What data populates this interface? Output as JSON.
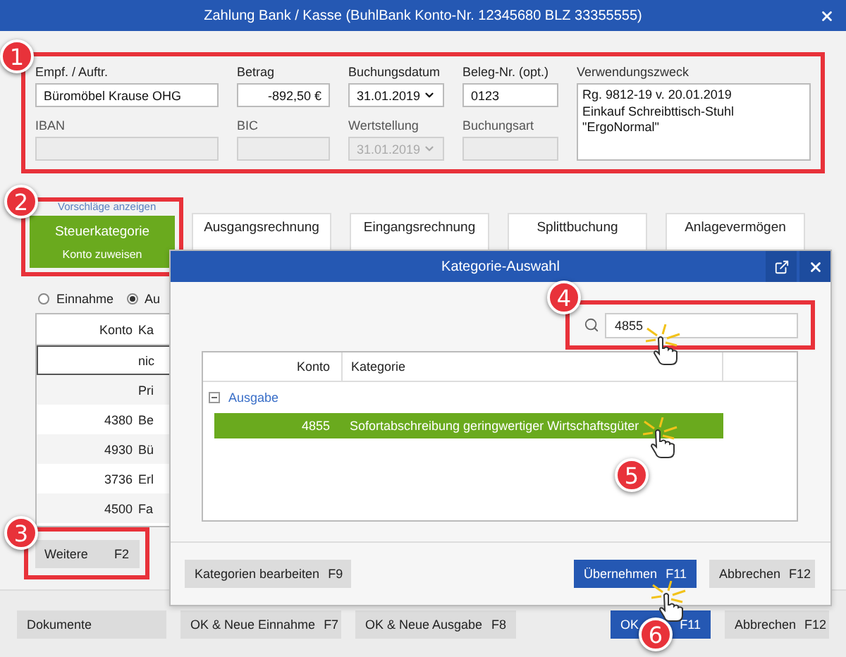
{
  "window": {
    "title": "Zahlung Bank / Kasse (BuhlBank Konto-Nr. 12345680  BLZ 33355555)"
  },
  "fields": [
    {
      "label": "Empf. / Auftr.",
      "value": "Büromöbel Krause OHG",
      "kind": "text",
      "disabled": false
    },
    {
      "label": "Betrag",
      "value": "-892,50 €",
      "kind": "amount",
      "disabled": false
    },
    {
      "label": "Buchungsdatum",
      "value": "31.01.2019",
      "kind": "select",
      "disabled": false
    },
    {
      "label": "Beleg-Nr. (opt.)",
      "value": "0123",
      "kind": "text",
      "disabled": false
    },
    {
      "label": "IBAN",
      "kind": "text",
      "disabled": true
    },
    {
      "label": "BIC",
      "kind": "text",
      "disabled": true
    },
    {
      "label": "Wertstellung",
      "value": "31.01.2019",
      "kind": "select",
      "disabled": true
    },
    {
      "label": "Buchungsart",
      "kind": "text",
      "disabled": true
    }
  ],
  "purpose": {
    "label": "Verwendungszweck",
    "value": "Rg. 9812-19 v. 20.01.2019\nEinkauf Schreibttisch-Stuhl\n\"ErgoNormal\""
  },
  "suggestions_label": "Vorschläge anzeigen",
  "main_tile": {
    "title": "Steuerkategorie",
    "subtitle": "Konto zuweisen"
  },
  "tiles": [
    "Ausgangsrechnung",
    "Eingangsrechnung",
    "Splittbuchung",
    "Anlagevermögen"
  ],
  "radios": [
    {
      "label": "Einnahme",
      "selected": false
    },
    {
      "label": "Au",
      "selected": true
    }
  ],
  "table": {
    "columns": [
      "Konto",
      "Ka"
    ],
    "rows": [
      {
        "kategorie": "nic",
        "selected": true
      },
      {
        "kategorie": "Pri",
        "selected": false
      },
      {
        "konto": "4380",
        "kategorie": "Be",
        "selected": false
      },
      {
        "konto": "4930",
        "kategorie": "Bü",
        "selected": false
      },
      {
        "konto": "3736",
        "kategorie": "Erl",
        "selected": false
      },
      {
        "konto": "4500",
        "kategorie": "Fa",
        "selected": false
      }
    ]
  },
  "more_button": {
    "label": "Weitere",
    "key": "F2"
  },
  "footer_buttons": [
    {
      "label": "Dokumente",
      "kind": "default"
    },
    {
      "label": "OK & Neue Einnahme",
      "key": "F7",
      "kind": "default"
    },
    {
      "label": "OK & Neue Ausgabe",
      "key": "F8",
      "kind": "default"
    },
    {
      "label": "OK",
      "key": "F11",
      "kind": "primary"
    },
    {
      "label": "Abbrechen",
      "key": "F12",
      "kind": "default"
    }
  ],
  "dialog": {
    "title": "Kategorie-Auswahl",
    "search": {
      "value": "4855"
    },
    "columns": [
      "Konto",
      "Kategorie"
    ],
    "groups": [
      {
        "label": "Ausgabe",
        "expanded": true,
        "rows": [
          {
            "konto": "4855",
            "kategorie": "Sofortabschreibung geringwertiger Wirtschaftsgüter",
            "selected": true
          }
        ]
      }
    ],
    "buttons": [
      {
        "label": "Kategorien bearbeiten",
        "key": "F9",
        "kind": "default"
      },
      {
        "label": "Übernehmen",
        "key": "F11",
        "kind": "primary"
      },
      {
        "label": "Abbrechen",
        "key": "F12",
        "kind": "default"
      }
    ]
  },
  "callouts": [
    "1",
    "2",
    "3",
    "4",
    "5",
    "6"
  ]
}
